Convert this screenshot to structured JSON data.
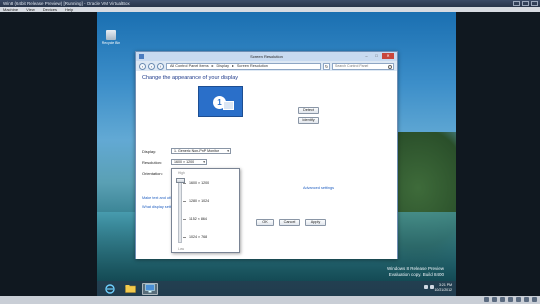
{
  "vbox": {
    "title": "Win8 (64bit Release Preview) [Running] - Oracle VM VirtualBox",
    "menu": [
      "Machine",
      "View",
      "Devices",
      "Help"
    ]
  },
  "desktop": {
    "recycle_bin": "Recycle Bin",
    "watermark": [
      "Windows 8 Release Preview",
      "Evaluation copy. Build 8400"
    ],
    "clock": [
      "3:21 PM",
      "10/21/2012"
    ]
  },
  "window": {
    "title": "Screen Resolution",
    "breadcrumb": [
      "All Control Panel Items",
      "Display",
      "Screen Resolution"
    ],
    "search_placeholder": "Search Control Panel",
    "heading": "Change the appearance of your display",
    "monitor_number": "1",
    "detect": "Detect",
    "identify": "Identify",
    "display_label": "Display:",
    "display_value": "1. Generic Non-PnP Monitor",
    "resolution_label": "Resolution:",
    "resolution_value": "1600 × 1200",
    "orientation_label": "Orientation:",
    "advanced": "Advanced settings",
    "link1": "Make text and other items larger or smaller",
    "link2": "What display settings should I choose?",
    "ok": "OK",
    "cancel": "Cancel",
    "apply": "Apply"
  },
  "resolution_slider": {
    "high": "High",
    "low": "Low",
    "options": [
      "1600 × 1200",
      "1280 × 1024",
      "1152 × 864",
      "1024 × 768"
    ],
    "selected": "1600 × 1200"
  }
}
